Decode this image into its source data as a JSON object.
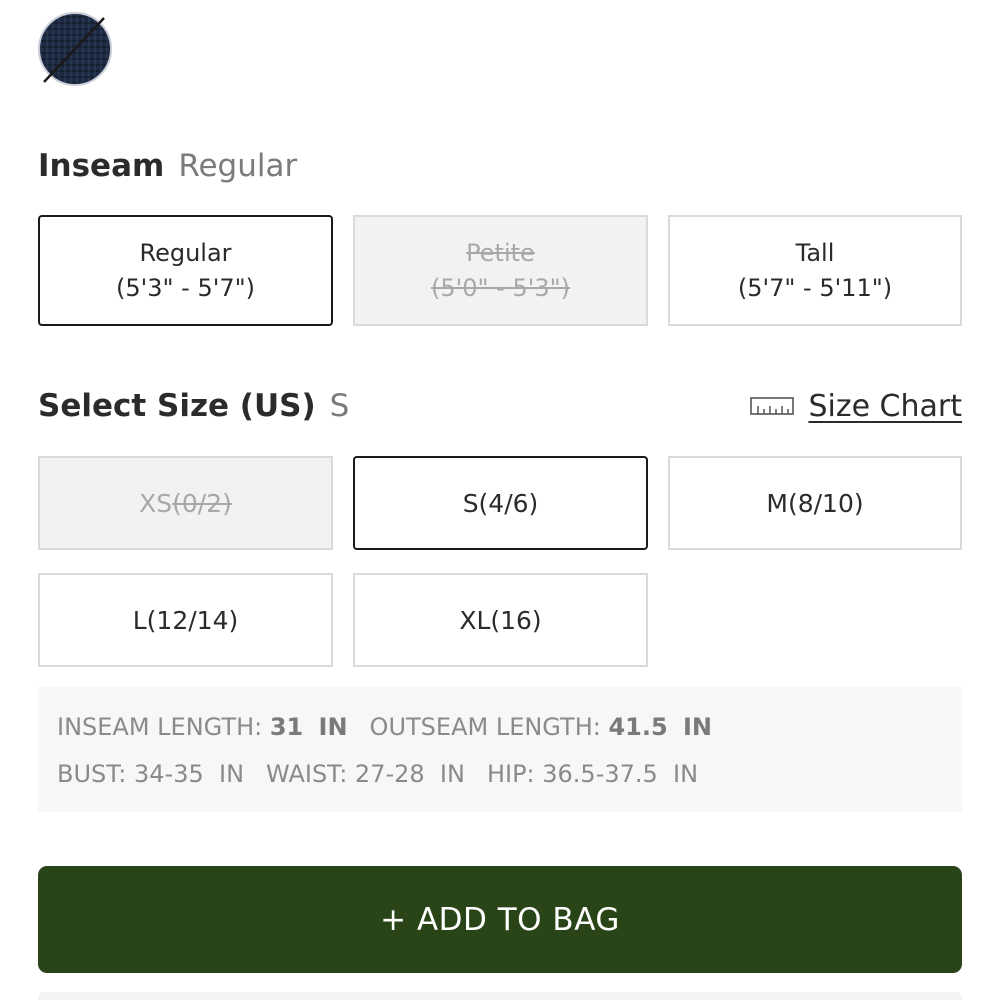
{
  "color_swatch": {
    "icon": "striped-fabric-swatch",
    "state": "unavailable",
    "base_color": "#1c2a44"
  },
  "inseam": {
    "label": "Inseam",
    "selected": "Regular",
    "options": [
      {
        "name": "Regular",
        "range": "(5'3\" - 5'7\")",
        "state": "selected"
      },
      {
        "name": "Petite",
        "range": "(5'0\" - 5'3\")",
        "state": "unavailable"
      },
      {
        "name": "Tall",
        "range": "(5'7\" - 5'11\")",
        "state": "available"
      }
    ]
  },
  "size": {
    "label": "Select Size (US)",
    "selected": "S",
    "size_chart_label": "Size Chart",
    "size_chart_icon": "ruler-icon",
    "options": [
      {
        "prefix": "XS",
        "label": "(0/2)",
        "state": "unavailable"
      },
      {
        "label": "S(4/6)",
        "state": "selected"
      },
      {
        "label": "M(8/10)",
        "state": "available"
      },
      {
        "label": "L(12/14)",
        "state": "available"
      },
      {
        "label": "XL(16)",
        "state": "available"
      }
    ]
  },
  "measurements": {
    "inseam_label": "INSEAM LENGTH:",
    "inseam_value": "31",
    "inseam_unit": "IN",
    "outseam_label": "OUTSEAM LENGTH:",
    "outseam_value": "41.5",
    "outseam_unit": "IN",
    "bust": "BUST: 34-35  IN",
    "waist": "WAIST: 27-28  IN",
    "hip": "HIP: 36.5-37.5  IN"
  },
  "add_to_bag": {
    "label": "+ ADD TO BAG",
    "color": "#294416"
  }
}
